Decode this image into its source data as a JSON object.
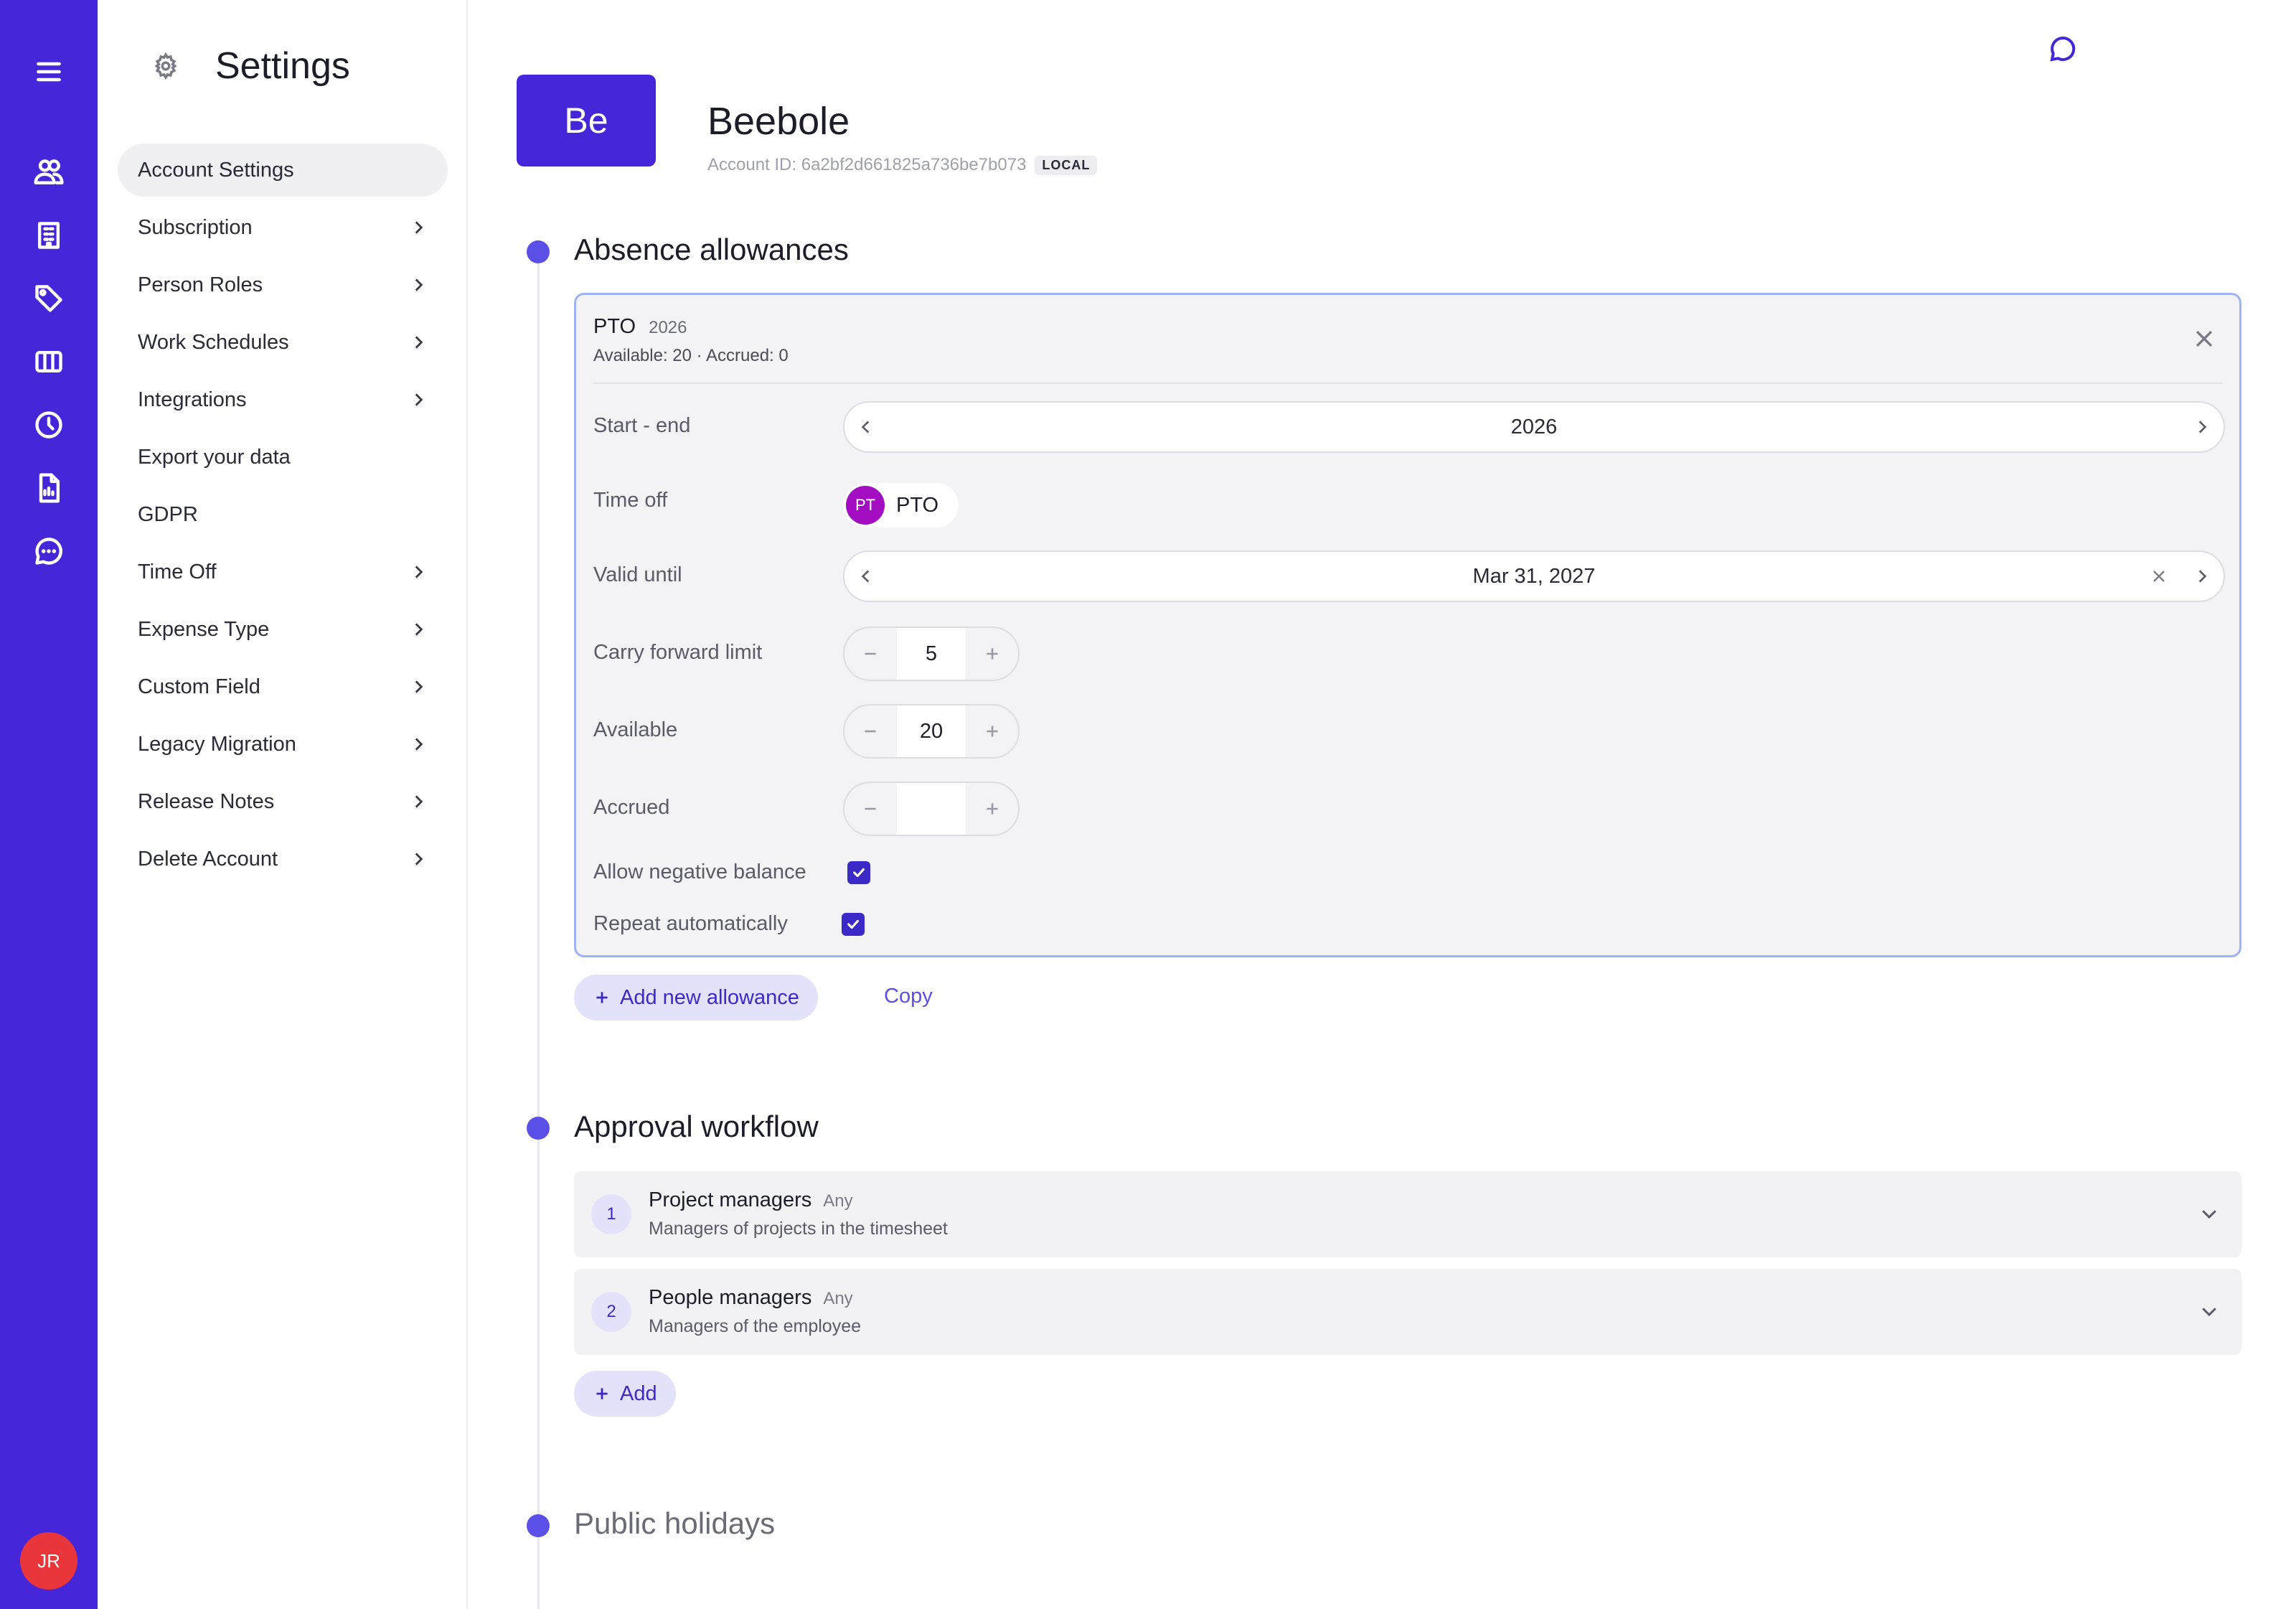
{
  "rail": {
    "items": [
      "menu-icon",
      "people-icon",
      "building-icon",
      "tag-icon",
      "columns-icon",
      "clock-icon",
      "report-icon",
      "chat-icon"
    ],
    "avatar": "JR",
    "color": "#4527d9"
  },
  "settings": {
    "title": "Settings",
    "nav": [
      {
        "label": "Account Settings",
        "chevron": false
      },
      {
        "label": "Subscription",
        "chevron": true
      },
      {
        "label": "Person Roles",
        "chevron": true
      },
      {
        "label": "Work Schedules",
        "chevron": true
      },
      {
        "label": "Integrations",
        "chevron": true
      },
      {
        "label": "Export your data",
        "chevron": false
      },
      {
        "label": "GDPR",
        "chevron": false
      },
      {
        "label": "Time Off",
        "chevron": true
      },
      {
        "label": "Expense Type",
        "chevron": true
      },
      {
        "label": "Custom Field",
        "chevron": true
      },
      {
        "label": "Legacy Migration",
        "chevron": true
      },
      {
        "label": "Release Notes",
        "chevron": true
      },
      {
        "label": "Delete Account",
        "chevron": true
      }
    ]
  },
  "account": {
    "logo": "Be",
    "name": "Beebole",
    "id_text": "Account ID: 6a2bf2d661825a736be7b073",
    "badge": "LOCAL"
  },
  "absence": {
    "title": "Absence allowances",
    "card": {
      "name": "PTO",
      "year": "2026",
      "summary": "Available: 20 · Accrued: 0",
      "labels": {
        "start_end": "Start - end",
        "time_off": "Time off",
        "valid_until": "Valid until",
        "carry": "Carry forward limit",
        "available": "Available",
        "accrued": "Accrued",
        "negative": "Allow negative balance",
        "repeat": "Repeat automatically"
      },
      "start_end_value": "2026",
      "time_off_chip": {
        "initials": "PT",
        "label": "PTO",
        "color": "#a20dc1"
      },
      "valid_until_value": "Mar 31, 2027",
      "carry_value": "5",
      "available_value": "20",
      "accrued_value": "",
      "allow_negative": true,
      "repeat_auto": true
    },
    "add_label": "Add new allowance",
    "copy_label": "Copy"
  },
  "approval": {
    "title": "Approval workflow",
    "steps": [
      {
        "num": "1",
        "title": "Project managers",
        "mode": "Any",
        "desc": "Managers of projects in the timesheet"
      },
      {
        "num": "2",
        "title": "People managers",
        "mode": "Any",
        "desc": "Managers of the employee"
      }
    ],
    "add_label": "Add"
  },
  "holidays": {
    "title": "Public holidays"
  }
}
